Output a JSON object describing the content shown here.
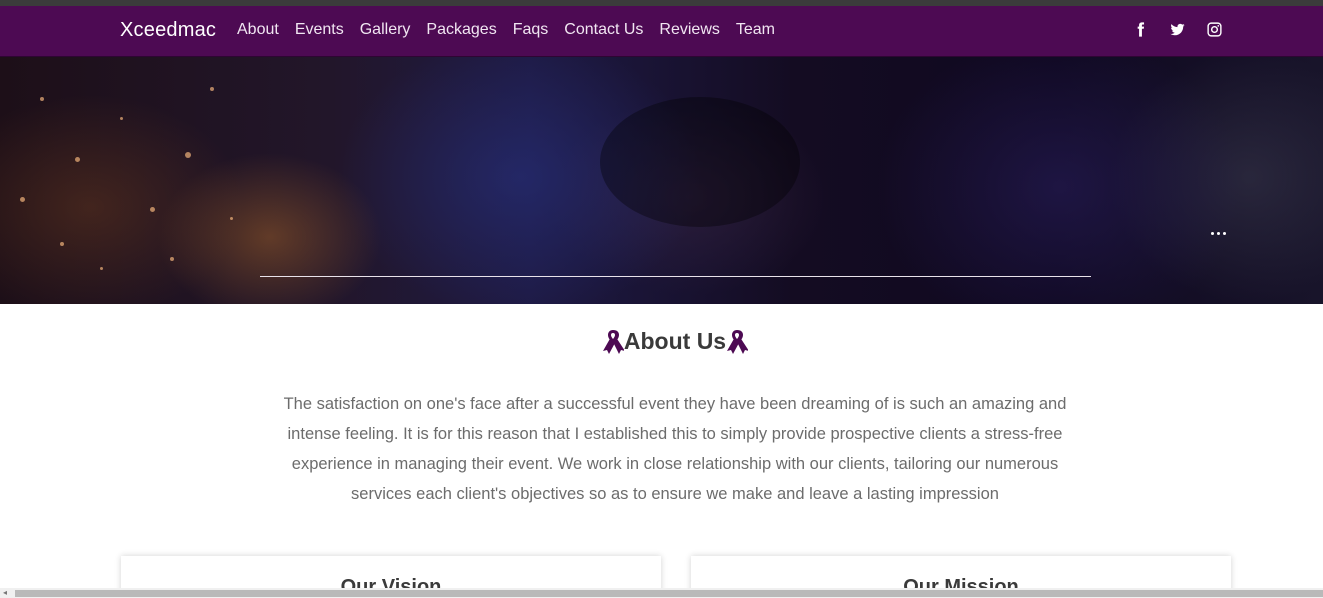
{
  "navbar": {
    "brand": "Xceedmac",
    "links": [
      "About",
      "Events",
      "Gallery",
      "Packages",
      "Faqs",
      "Contact Us",
      "Reviews",
      "Team"
    ],
    "social": [
      "facebook-icon",
      "twitter-icon",
      "instagram-icon"
    ],
    "background": "#4d0a53"
  },
  "about": {
    "title": "About Us",
    "ribbon_icon": "ribbon-icon",
    "ribbon_color": "#4d0a53",
    "text": "The satisfaction on one's face after a successful event they have been dreaming of is such an amazing and intense feeling. It is for this reason that I established this to simply provide prospective clients a stress-free experience in managing their event. We work in close relationship with our clients, tailoring our numerous services each client's objectives so as to ensure we make and leave a lasting impression"
  },
  "cards": {
    "vision": "Our Vision",
    "mission": "Our Mission"
  }
}
